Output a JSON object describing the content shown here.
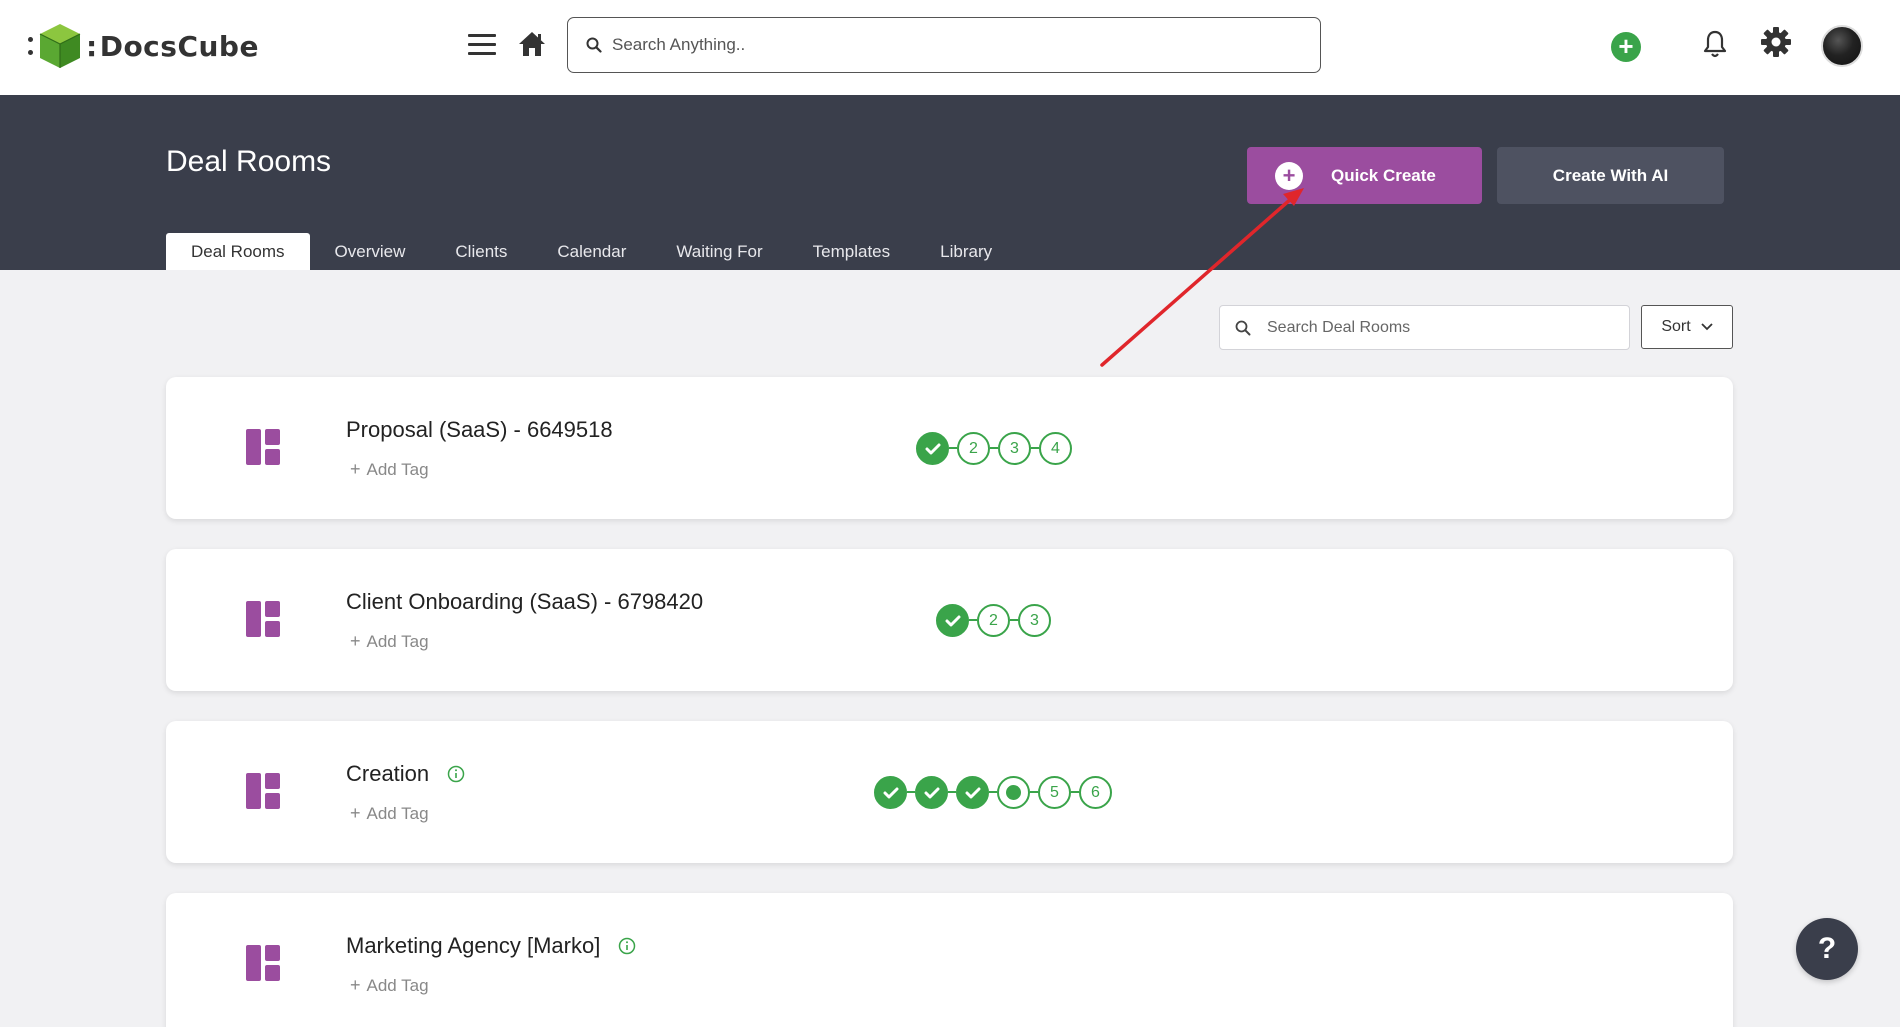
{
  "app": {
    "brand_left": ":",
    "brand_name": "DocsCube"
  },
  "topbar": {
    "search_placeholder": "Search Anything..",
    "add_label": "+"
  },
  "header": {
    "title": "Deal Rooms",
    "quick_create_label": "Quick Create",
    "create_ai_label": "Create With AI",
    "tabs": [
      "Deal Rooms",
      "Overview",
      "Clients",
      "Calendar",
      "Waiting For",
      "Templates",
      "Library"
    ],
    "active_tab": "Deal Rooms"
  },
  "list": {
    "search_placeholder": "Search Deal Rooms",
    "sort_label": "Sort"
  },
  "rooms": [
    {
      "title": "Proposal (SaaS) - 6649518",
      "info": false,
      "add_tag": "Add Tag",
      "steps": [
        {
          "state": "done",
          "label": ""
        },
        {
          "state": "todo",
          "label": "2"
        },
        {
          "state": "todo",
          "label": "3"
        },
        {
          "state": "todo",
          "label": "4"
        }
      ]
    },
    {
      "title": "Client Onboarding (SaaS) - 6798420",
      "info": false,
      "add_tag": "Add Tag",
      "steps": [
        {
          "state": "done",
          "label": ""
        },
        {
          "state": "todo",
          "label": "2"
        },
        {
          "state": "todo",
          "label": "3"
        }
      ]
    },
    {
      "title": "Creation",
      "info": true,
      "add_tag": "Add Tag",
      "steps": [
        {
          "state": "done",
          "label": ""
        },
        {
          "state": "done",
          "label": ""
        },
        {
          "state": "done",
          "label": ""
        },
        {
          "state": "current",
          "label": ""
        },
        {
          "state": "todo",
          "label": "5"
        },
        {
          "state": "todo",
          "label": "6"
        }
      ]
    },
    {
      "title": "Marketing Agency [Marko]",
      "info": true,
      "add_tag": "Add Tag",
      "steps": []
    }
  ],
  "help_label": "?",
  "colors": {
    "brand_purple": "#9b4d9f",
    "header_dark": "#3a3e4b",
    "success_green": "#3aa44a",
    "arrow_red": "#e0262b"
  }
}
